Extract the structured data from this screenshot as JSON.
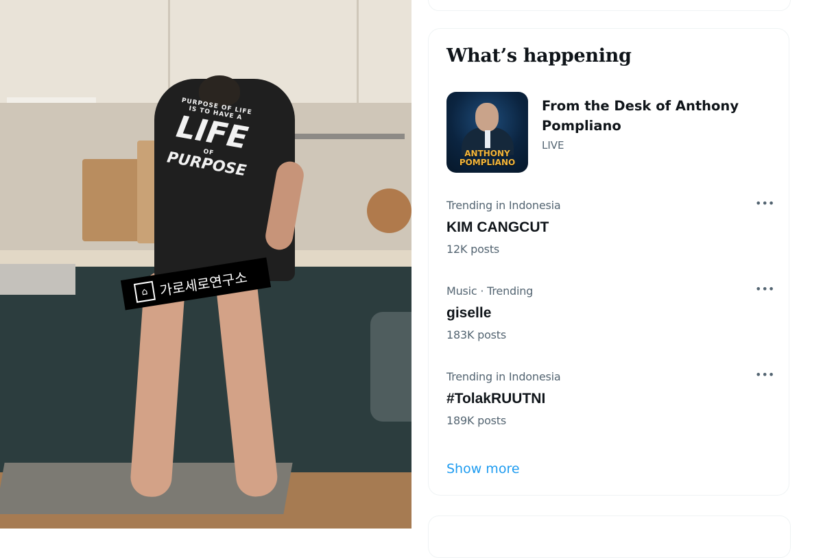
{
  "photo": {
    "shirt_text": [
      "PURPOSE OF LIFE",
      "IS TO HAVE A",
      "LIFE",
      "OF",
      "PURPOSE"
    ],
    "watermark": "가로세로연구소"
  },
  "whats_happening": {
    "title": "What’s happening",
    "live": {
      "title": "From the Desk of Anthony Pompliano",
      "status": "LIVE",
      "thumbnail_text": [
        "ANTHONY",
        "POMPLIANO"
      ]
    },
    "trends": [
      {
        "context": "Trending in Indonesia",
        "topic": "KIM CANGCUT",
        "count": "12K posts",
        "more_icon": "more-horizontal-icon"
      },
      {
        "context": "Music · Trending",
        "topic": "giselle",
        "count": "183K posts",
        "more_icon": "more-horizontal-icon"
      },
      {
        "context": "Trending in Indonesia",
        "topic": "#TolakRUUTNI",
        "count": "189K posts",
        "more_icon": "more-horizontal-icon"
      }
    ],
    "show_more": "Show more",
    "accent_color": "#1d9bf0"
  }
}
